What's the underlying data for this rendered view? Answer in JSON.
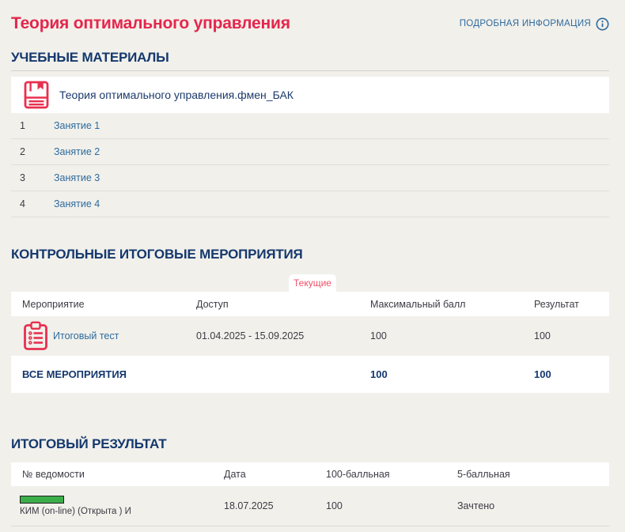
{
  "page": {
    "title": "Теория оптимального управления",
    "details_link": "ПОДРОБНАЯ ИНФОРМАЦИЯ"
  },
  "materials": {
    "heading": "УЧЕБНЫЕ МАТЕРИАЛЫ",
    "course_file": "Теория оптимального управления.фмен_БАК",
    "items": [
      {
        "num": "1",
        "label": "Занятие 1"
      },
      {
        "num": "2",
        "label": "Занятие 2"
      },
      {
        "num": "3",
        "label": "Занятие 3"
      },
      {
        "num": "4",
        "label": "Занятие 4"
      }
    ]
  },
  "control_events": {
    "heading": "КОНТРОЛЬНЫЕ ИТОГОВЫЕ МЕРОПРИЯТИЯ",
    "tab": "Текущие",
    "columns": [
      "Мероприятие",
      "Доступ",
      "Максимальный балл",
      "Результат"
    ],
    "rows": [
      {
        "name": "Итоговый тест",
        "access": "01.04.2025 - 15.09.2025",
        "max_score": "100",
        "result": "100"
      }
    ],
    "footer": {
      "label": "ВСЕ МЕРОПРИЯТИЯ",
      "max_score": "100",
      "result": "100"
    }
  },
  "final_result": {
    "heading": "ИТОГОВЫЙ РЕЗУЛЬТАТ",
    "columns": [
      "№ ведомости",
      "Дата",
      "100-балльная",
      "5-балльная"
    ],
    "rows": [
      {
        "sheet": "КИМ (on-line) (Открыта ) И",
        "date": "18.07.2025",
        "score100": "100",
        "score5": "Зачтено"
      }
    ]
  },
  "icons": {
    "info": "info-icon (circled i)",
    "book": "book-icon (red book with bookmark)",
    "clipboard": "clipboard-icon (red clipboard with list)"
  },
  "colors": {
    "accent_red": "#e4264c",
    "icon_red": "#e8304f",
    "tab_red": "#ed5068",
    "navy": "#15386d",
    "link_blue": "#2e6b9e",
    "text": "#3b3b44",
    "progress_green": "#3cae49",
    "page_bg": "#f1f0eb",
    "card_bg": "#ffffff"
  }
}
